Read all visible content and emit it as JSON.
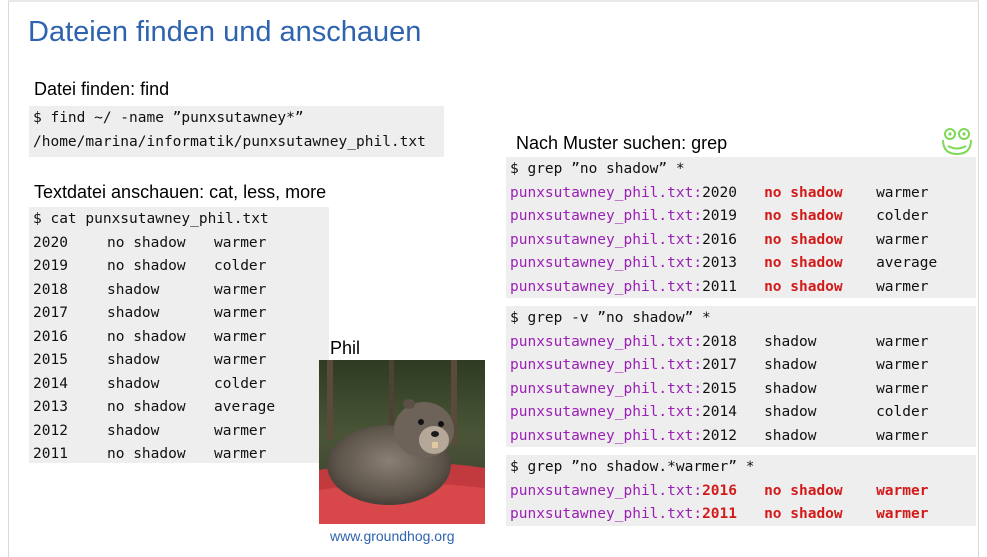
{
  "title": "Dateien finden und anschauen",
  "find_section": {
    "heading": "Datei finden: find",
    "lines": [
      "$ find ~/ -name ”punxsutawney*”",
      "/home/marina/informatik/punxsutawney_phil.txt"
    ]
  },
  "cat_section": {
    "heading": "Textdatei anschauen: cat, less, more",
    "command": "$ cat punxsutawney_phil.txt",
    "rows": [
      {
        "year": "2020",
        "shadow": "no shadow",
        "weather": "warmer"
      },
      {
        "year": "2019",
        "shadow": "no shadow",
        "weather": "colder"
      },
      {
        "year": "2018",
        "shadow": "shadow",
        "weather": "warmer"
      },
      {
        "year": "2017",
        "shadow": "shadow",
        "weather": "warmer"
      },
      {
        "year": "2016",
        "shadow": "no shadow",
        "weather": "warmer"
      },
      {
        "year": "2015",
        "shadow": "shadow",
        "weather": "warmer"
      },
      {
        "year": "2014",
        "shadow": "shadow",
        "weather": "colder"
      },
      {
        "year": "2013",
        "shadow": "no shadow",
        "weather": "average"
      },
      {
        "year": "2012",
        "shadow": "shadow",
        "weather": "warmer"
      },
      {
        "year": "2011",
        "shadow": "no shadow",
        "weather": "warmer"
      }
    ]
  },
  "phil": {
    "label": "Phil",
    "caption": "www.groundhog.org"
  },
  "grep_section": {
    "heading": "Nach Muster suchen: grep",
    "blocks": [
      {
        "command": "$ grep ”no shadow” *",
        "rows": [
          {
            "file": "punxsutawney_phil.txt:",
            "year": "2020",
            "shadow": "no shadow",
            "weather": "warmer"
          },
          {
            "file": "punxsutawney_phil.txt:",
            "year": "2019",
            "shadow": "no shadow",
            "weather": "colder"
          },
          {
            "file": "punxsutawney_phil.txt:",
            "year": "2016",
            "shadow": "no shadow",
            "weather": "warmer"
          },
          {
            "file": "punxsutawney_phil.txt:",
            "year": "2013",
            "shadow": "no shadow",
            "weather": "average"
          },
          {
            "file": "punxsutawney_phil.txt:",
            "year": "2011",
            "shadow": "no shadow",
            "weather": "warmer"
          }
        ]
      },
      {
        "command": "$ grep -v ”no shadow” *",
        "rows": [
          {
            "file": "punxsutawney_phil.txt:",
            "year": "2018",
            "shadow": "shadow",
            "weather": "warmer"
          },
          {
            "file": "punxsutawney_phil.txt:",
            "year": "2017",
            "shadow": "shadow",
            "weather": "warmer"
          },
          {
            "file": "punxsutawney_phil.txt:",
            "year": "2015",
            "shadow": "shadow",
            "weather": "warmer"
          },
          {
            "file": "punxsutawney_phil.txt:",
            "year": "2014",
            "shadow": "shadow",
            "weather": "colder"
          },
          {
            "file": "punxsutawney_phil.txt:",
            "year": "2012",
            "shadow": "shadow",
            "weather": "warmer"
          }
        ]
      },
      {
        "command": "$ grep ”no shadow.*warmer” *",
        "rows": [
          {
            "file": "punxsutawney_phil.txt:",
            "year": "2016",
            "shadow": "no shadow",
            "weather": "warmer"
          },
          {
            "file": "punxsutawney_phil.txt:",
            "year": "2011",
            "shadow": "no shadow",
            "weather": "warmer"
          }
        ]
      }
    ]
  },
  "colors": {
    "title": "#2e63b0",
    "filename": "#9b1fb5",
    "match": "#d21a1a",
    "code_background": "#eeeeee",
    "logo": "#7ed957"
  },
  "icons": {
    "logo": "frog-logo-icon"
  }
}
